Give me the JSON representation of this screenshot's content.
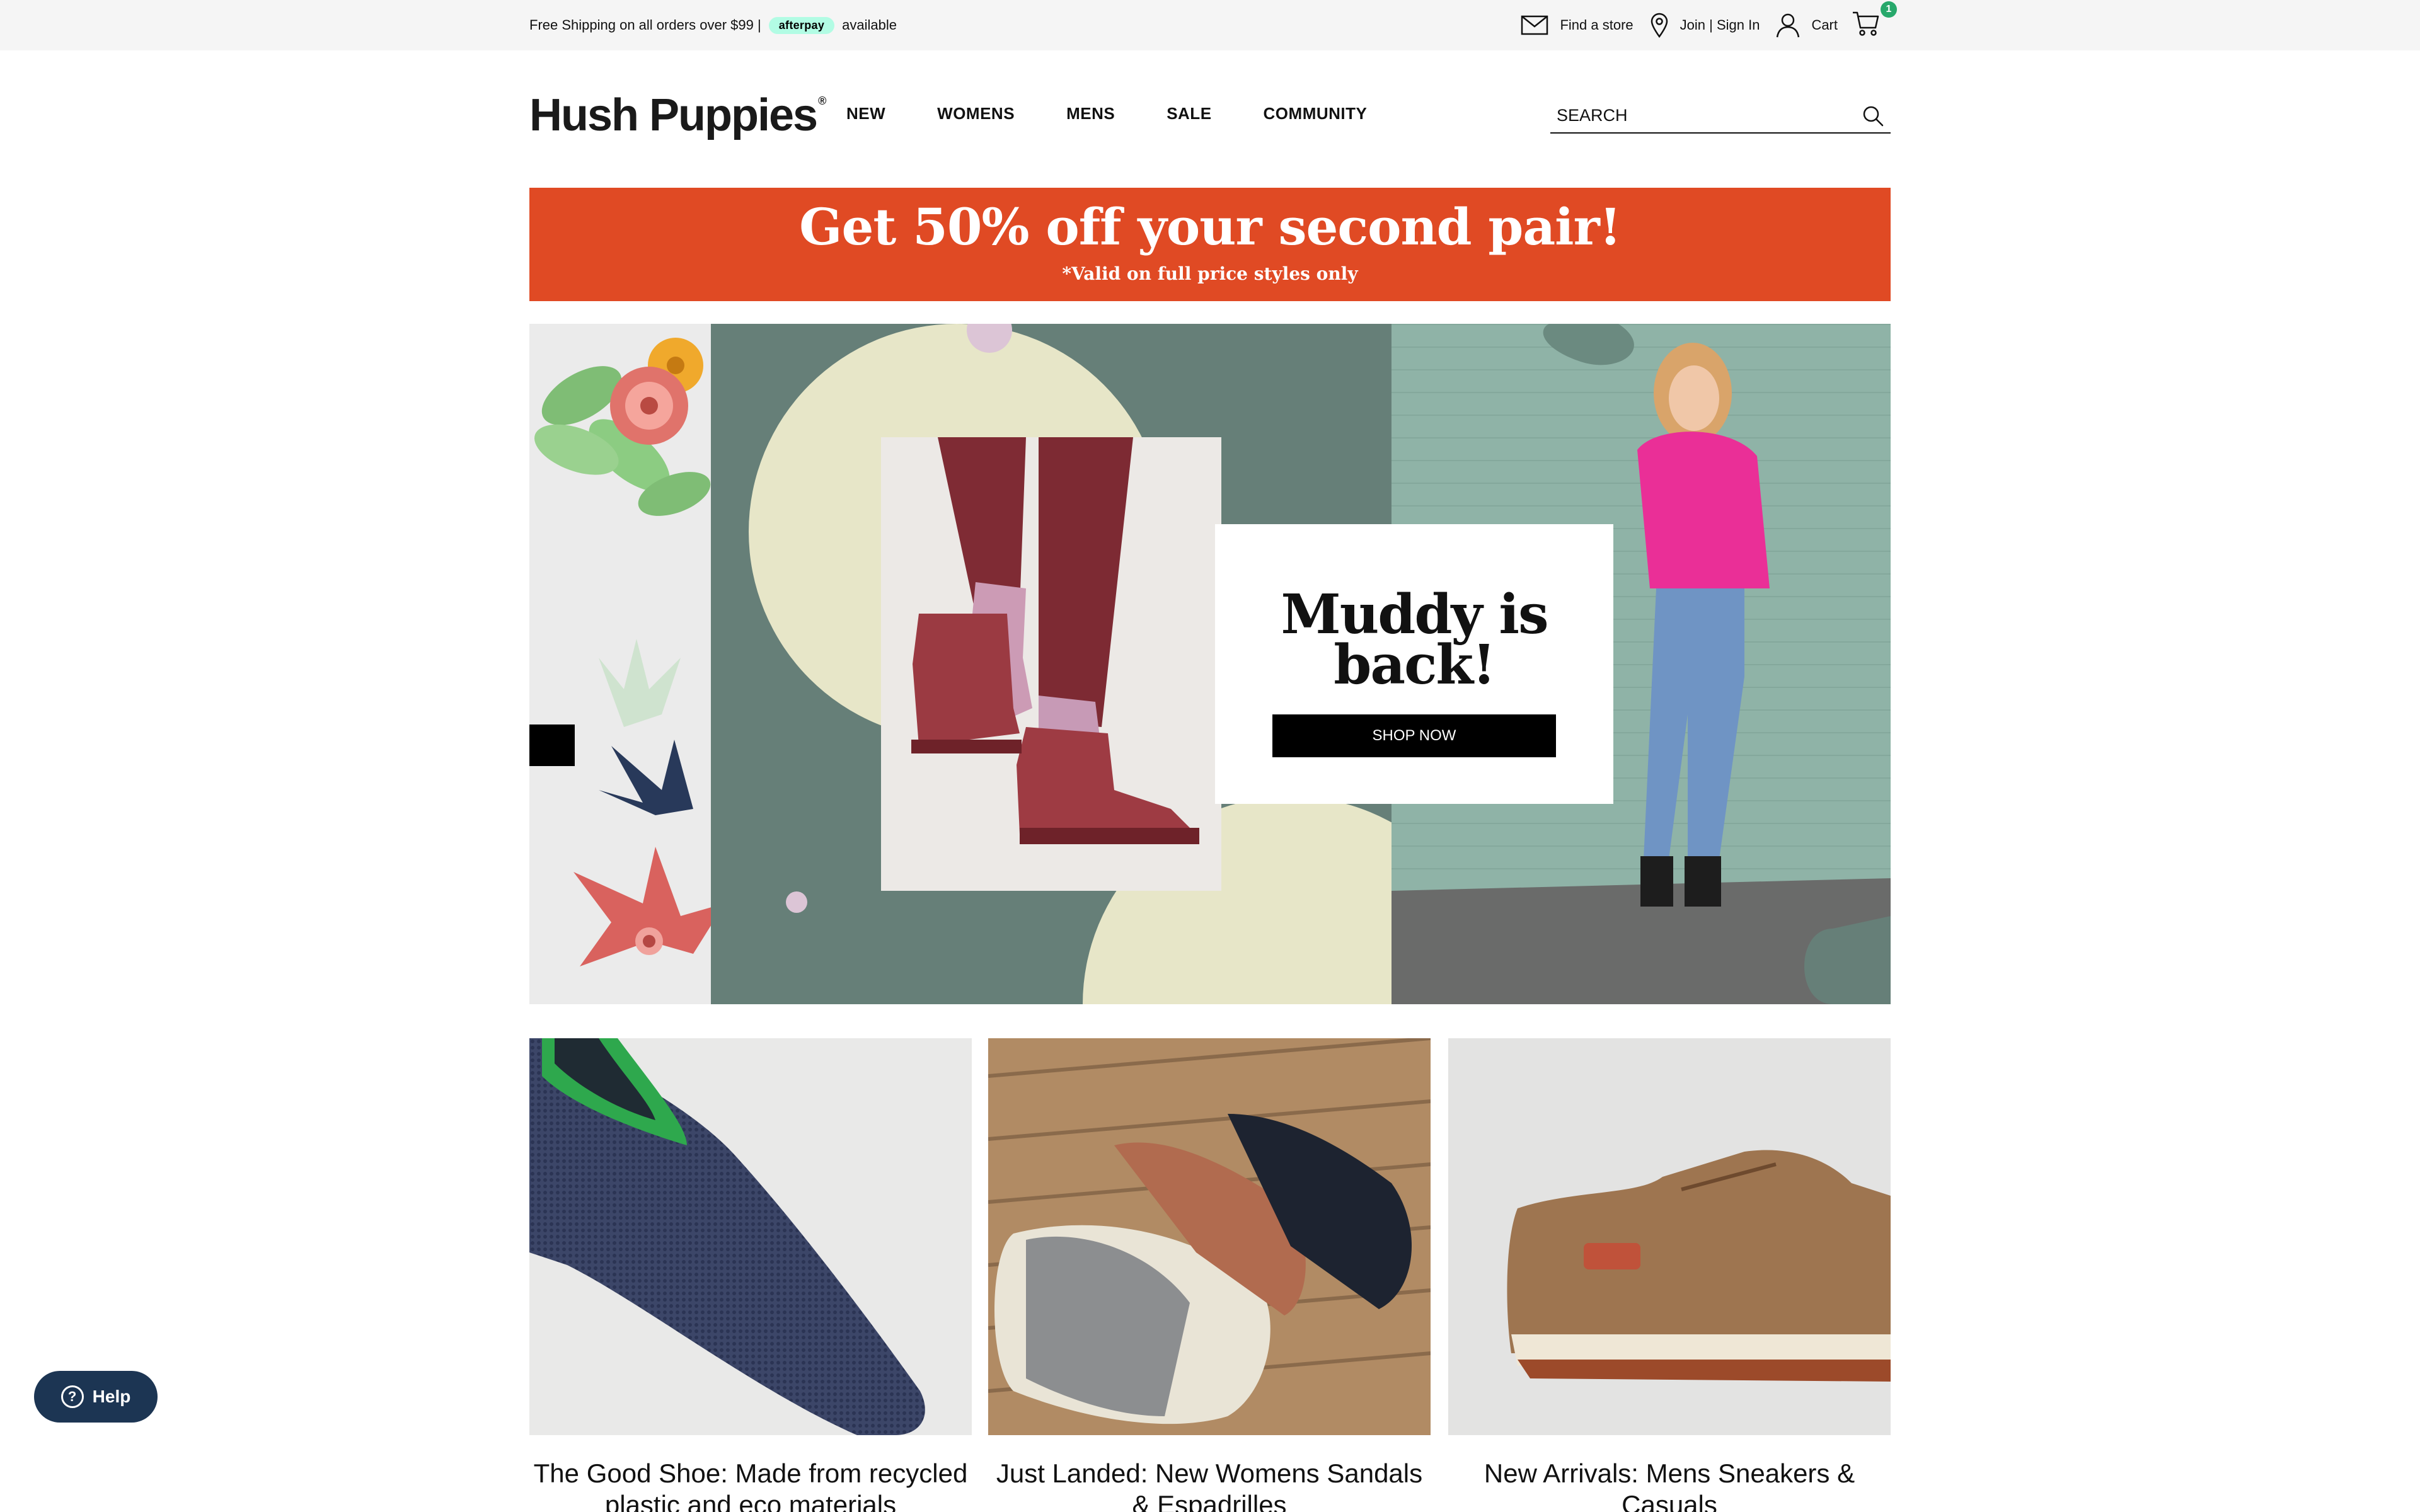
{
  "utility": {
    "shipping_text": "Free Shipping on all orders over $99 |",
    "afterpay_label": "afterpay",
    "afterpay_suffix": "available",
    "find_store": "Find a store",
    "join_sign_in": "Join | Sign In",
    "cart": "Cart",
    "cart_count": "1"
  },
  "header": {
    "logo": "Hush Puppies",
    "logo_mark": "®",
    "nav": [
      "NEW",
      "WOMENS",
      "MENS",
      "SALE",
      "COMMUNITY"
    ],
    "search_placeholder": "SEARCH"
  },
  "promo": {
    "title": "Get 50% off your second pair!",
    "subtitle": "*Valid on full price styles only",
    "background": "#e04a24"
  },
  "hero": {
    "headline": "Muddy is back!",
    "cta": "SHOP NOW"
  },
  "tiles": [
    {
      "caption": "The Good Shoe: Made from recycled plastic and eco materials"
    },
    {
      "caption": "Just Landed: New Womens Sandals & Espadrilles"
    },
    {
      "caption": "New Arrivals: Mens Sneakers & Casuals"
    }
  ],
  "help": {
    "label": "Help"
  },
  "icons": [
    "mail-icon",
    "location-pin-icon",
    "user-icon",
    "cart-icon",
    "search-icon",
    "help-icon"
  ]
}
